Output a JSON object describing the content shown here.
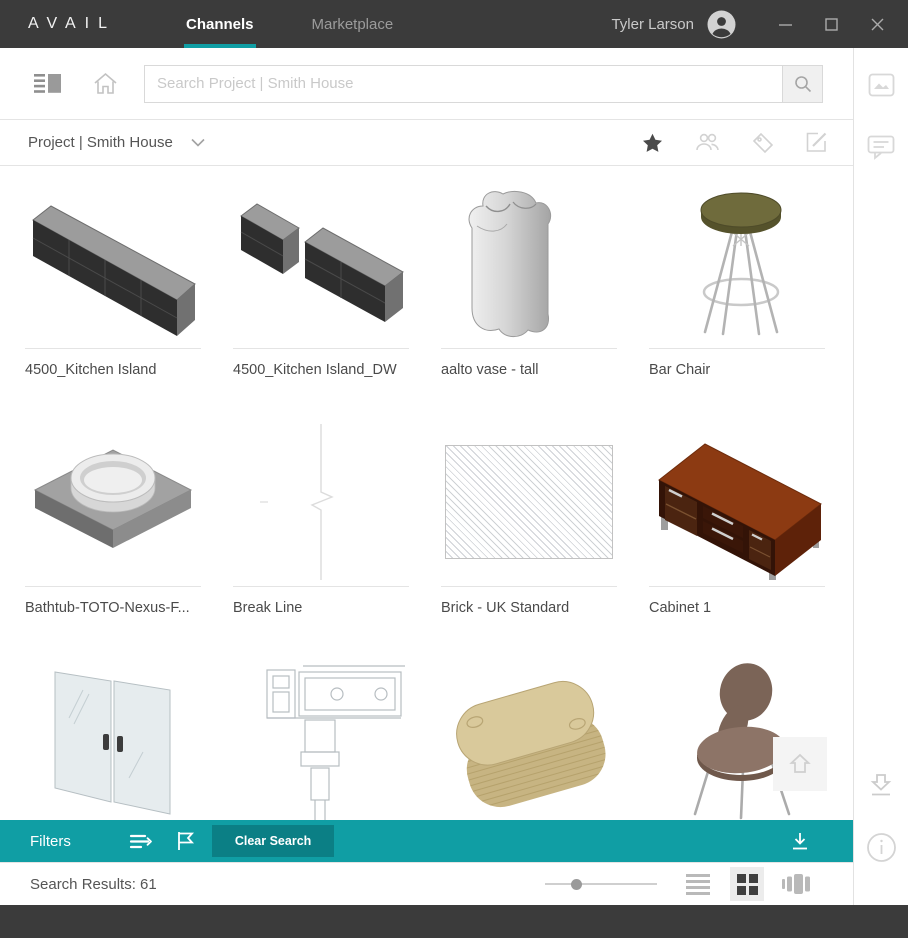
{
  "titlebar": {
    "logo": "AVAIL",
    "tabs": [
      {
        "label": "Channels",
        "active": true
      },
      {
        "label": "Marketplace",
        "active": false
      }
    ],
    "user_name": "Tyler Larson"
  },
  "toolbar": {
    "search_placeholder": "Search Project | Smith House"
  },
  "project_bar": {
    "selector_label": "Project | Smith House"
  },
  "grid": {
    "items": [
      {
        "label": "4500_Kitchen Island"
      },
      {
        "label": "4500_Kitchen Island_DW"
      },
      {
        "label": "aalto vase - tall"
      },
      {
        "label": "Bar Chair"
      },
      {
        "label": "Bathtub-TOTO-Nexus-F..."
      },
      {
        "label": "Break Line"
      },
      {
        "label": "Brick - UK Standard"
      },
      {
        "label": "Cabinet 1"
      },
      {
        "label": ""
      },
      {
        "label": ""
      },
      {
        "label": ""
      },
      {
        "label": ""
      }
    ]
  },
  "filter_bar": {
    "title": "Filters",
    "clear_button_label": "Clear Search"
  },
  "status_bar": {
    "results_label": "Search Results: 61",
    "slider_fraction": 0.28
  },
  "icons": {
    "titlebar": [
      "minimize-icon",
      "maximize-icon",
      "close-icon",
      "avatar-icon"
    ],
    "toolbar": [
      "panel-toggle-icon",
      "home-icon",
      "search-icon"
    ],
    "project_bar": [
      "chevron-down-icon",
      "star-icon",
      "users-icon",
      "tag-icon",
      "edit-icon"
    ],
    "filter_bar": [
      "sort-lines-icon",
      "flag-icon",
      "download-icon"
    ],
    "status_bar": [
      "list-view-icon",
      "grid-view-icon",
      "carousel-view-icon"
    ],
    "sidebar": [
      "image-icon",
      "comment-icon",
      "download-tray-icon",
      "info-icon"
    ],
    "content": [
      "scroll-top-icon"
    ]
  },
  "colors": {
    "accent_teal": "#109EA4",
    "accent_teal_dark": "#0B7F85",
    "titlebar_bg": "#3B3B3B"
  }
}
